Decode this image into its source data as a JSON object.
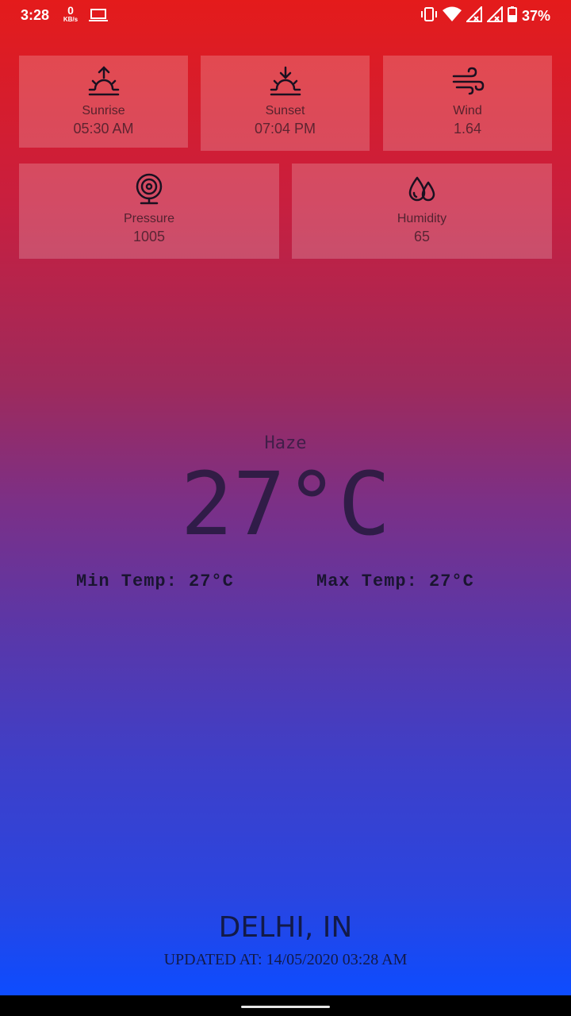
{
  "status_bar": {
    "time": "3:28",
    "speed_value": "0",
    "speed_unit": "KB/s",
    "battery_percent": "37%",
    "icons": [
      "laptop-icon",
      "vibrate-icon",
      "wifi-icon",
      "signal-icon",
      "signal-icon",
      "battery-icon"
    ]
  },
  "tiles": {
    "sunrise": {
      "label": "Sunrise",
      "value": "05:30 AM",
      "icon": "sunrise-icon"
    },
    "sunset": {
      "label": "Sunset",
      "value": "07:04 PM",
      "icon": "sunset-icon"
    },
    "wind": {
      "label": "Wind",
      "value": "1.64",
      "icon": "wind-icon"
    },
    "pressure": {
      "label": "Pressure",
      "value": "1005",
      "icon": "pressure-icon"
    },
    "humidity": {
      "label": "Humidity",
      "value": "65",
      "icon": "humidity-icon"
    }
  },
  "weather": {
    "condition": "Haze",
    "temperature": "27°C",
    "min_temp": "Min Temp: 27°C",
    "max_temp": "Max Temp: 27°C"
  },
  "location": {
    "city": "DELHI, IN",
    "updated_at": "UPDATED AT: 14/05/2020 03:28 AM"
  },
  "colors": {
    "gradient_top": "#e41b1b",
    "gradient_bottom": "#0d4cff",
    "text_dark": "#121a48"
  }
}
